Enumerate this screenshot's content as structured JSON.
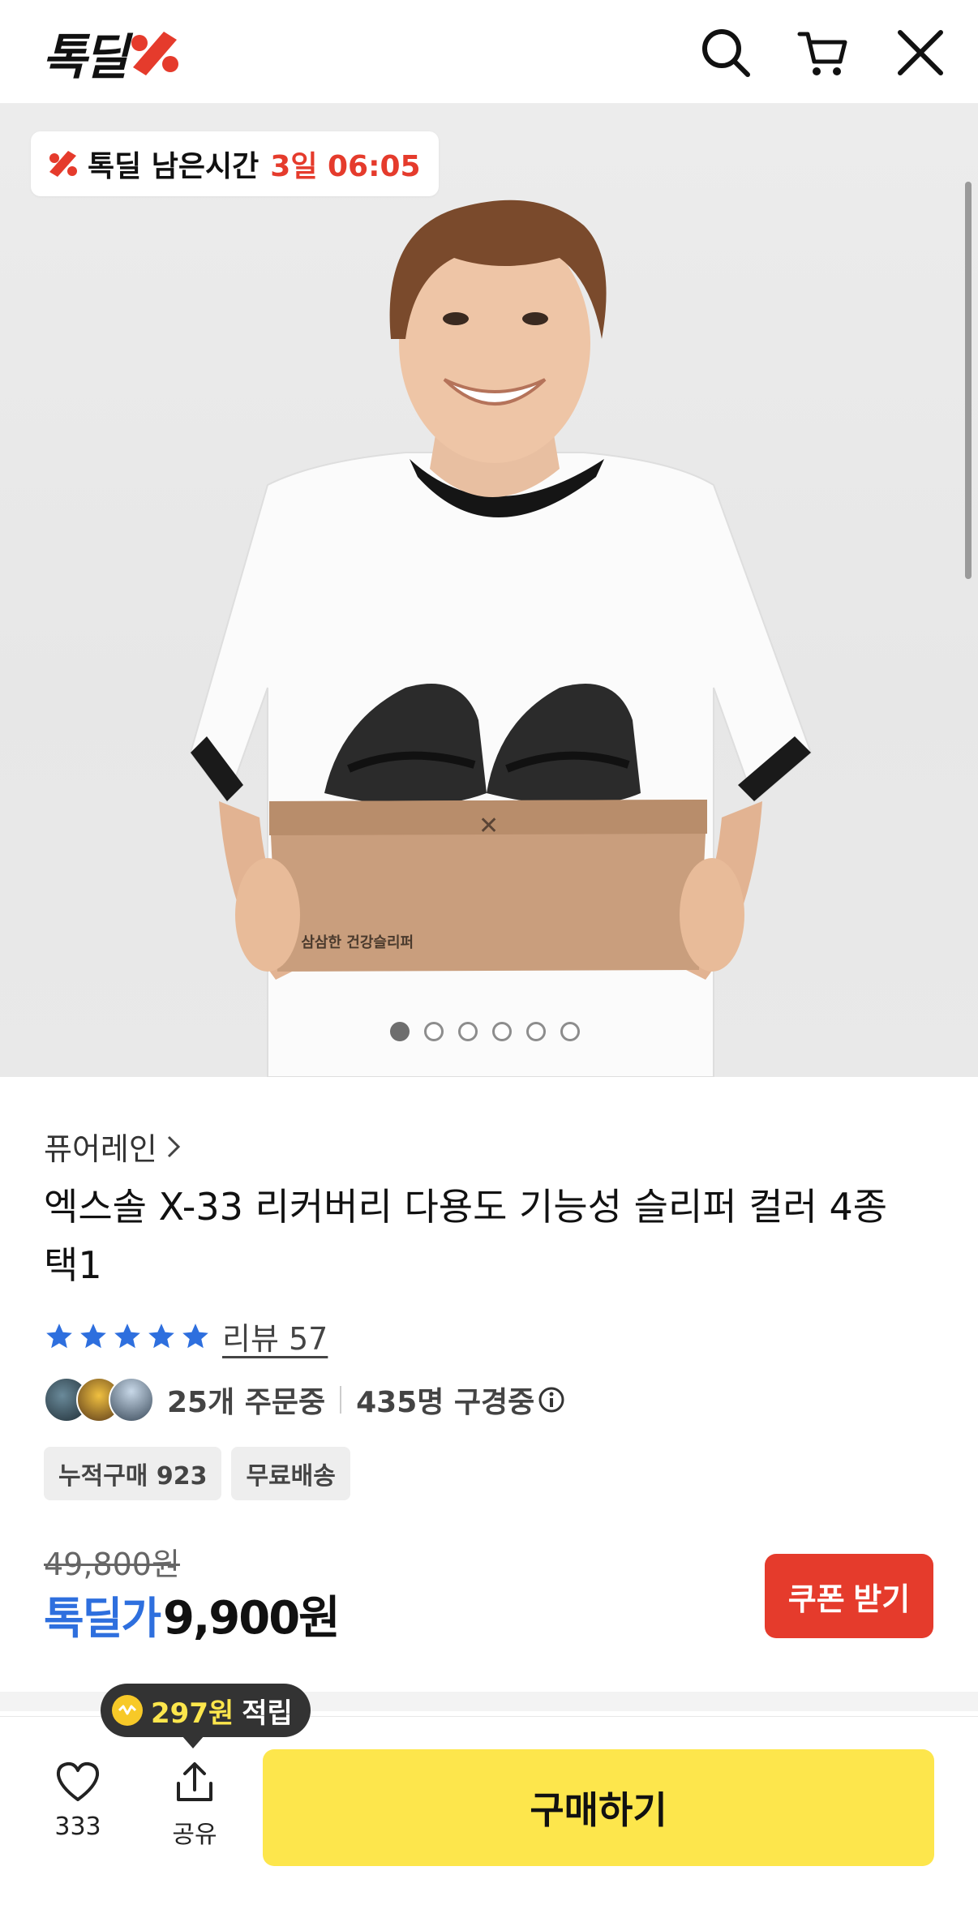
{
  "header": {
    "logo_text": "톡딜",
    "icons": [
      "search-icon",
      "cart-icon",
      "close-icon"
    ]
  },
  "hero": {
    "timer_label": "톡딜 남은시간",
    "timer_value": "3일 06:05",
    "carousel_total": 6,
    "carousel_active": 1
  },
  "product": {
    "brand": "퓨어레인",
    "title": "엑스솔 X-33 리커버리 다용도 기능성 슬리퍼 컬러 4종 택1",
    "rating_stars": 5,
    "review_label": "리뷰 57",
    "orders_text": "25개 주문중",
    "viewers_text": "435명 구경중",
    "chips": [
      "누적구매 923",
      "무료배송"
    ],
    "original_price": "49,800원",
    "deal_label": "톡딜가",
    "deal_price": "9,900원",
    "coupon_label": "쿠폰 받기"
  },
  "bottom_bar": {
    "like_count": "333",
    "share_label": "공유",
    "buy_label": "구매하기",
    "points_amount": "297원",
    "points_suffix": "적립"
  },
  "colors": {
    "accent_red": "#e53b2c",
    "deal_blue": "#2e6fde",
    "buy_yellow": "#fde64c"
  }
}
